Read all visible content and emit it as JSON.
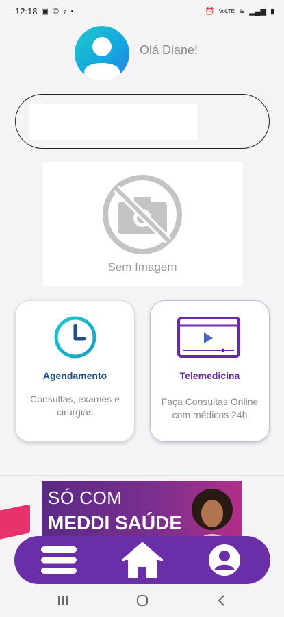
{
  "status_bar": {
    "time": "12:18",
    "left_icons": [
      "image-icon",
      "whatsapp-icon",
      "bell-icon",
      "dot-icon"
    ],
    "right_icons": [
      "alarm-icon",
      "volte-icon",
      "wifi-icon",
      "signal-icon",
      "battery-icon"
    ]
  },
  "header": {
    "greeting": "Olá Diane!",
    "avatar_icon": "user-icon"
  },
  "search": {
    "placeholder": ""
  },
  "image_placeholder": {
    "label": "Sem Imagem",
    "icon": "no-camera-icon"
  },
  "cards": {
    "agendamento": {
      "title": "Agendamento",
      "description": "Consultas, exames e cirurgias",
      "icon": "clock-icon",
      "color": "#1a4f8e"
    },
    "telemedicina": {
      "title": "Telemedicina",
      "description": "Faça Consultas Online com médicos 24h",
      "icon": "video-play-icon",
      "color": "#6a2aa8"
    }
  },
  "banner": {
    "line1": "SÓ COM",
    "line2": "MEDDI SAÚDE"
  },
  "bottom_nav": {
    "items": [
      "menu-icon",
      "home-icon",
      "profile-icon"
    ],
    "color": "#6a2ea8"
  },
  "system_nav": {
    "items": [
      "recent-apps-icon",
      "home-circle-icon",
      "back-icon"
    ]
  }
}
